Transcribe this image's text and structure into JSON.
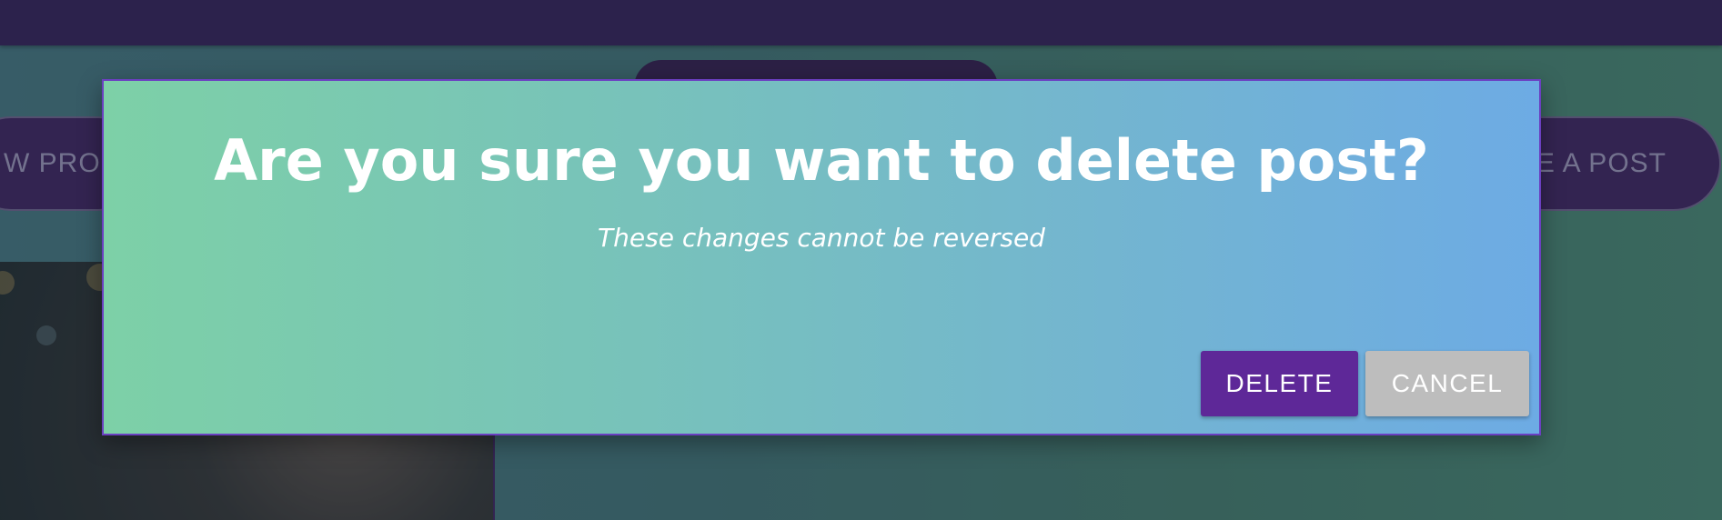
{
  "background": {
    "nav_left_label": "W PROF",
    "nav_right_label": "KE A POST"
  },
  "dialog": {
    "title": "Are you sure you want to delete post?",
    "subtitle": "These changes cannot be reversed",
    "delete_label": "DELETE",
    "cancel_label": "CANCEL"
  },
  "colors": {
    "topbar": "#2f1450",
    "dialog_gradient_start": "#7dd0a7",
    "dialog_gradient_end": "#6dabe4",
    "dialog_border": "#6b3fc1",
    "delete_button": "#5e2898",
    "cancel_button": "#bdbdbd"
  }
}
